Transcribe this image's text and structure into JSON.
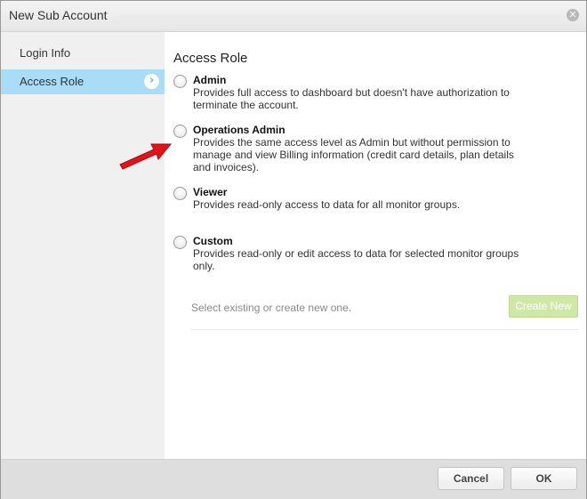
{
  "dialog": {
    "title": "New Sub Account",
    "close_icon": "close-icon"
  },
  "sidebar": {
    "items": [
      {
        "label": "Login Info",
        "active": false
      },
      {
        "label": "Access Role",
        "active": true,
        "icon": "chevron-right-icon"
      }
    ]
  },
  "main": {
    "heading": "Access Role",
    "options": [
      {
        "title": "Admin",
        "description": "Provides full access to dashboard but doesn't have authorization to terminate the account.",
        "selected": false
      },
      {
        "title": "Operations Admin",
        "description": "Provides the same access level as Admin but without permission to manage and view Billing information (credit card details, plan details and invoices).",
        "selected": false
      },
      {
        "title": "Viewer",
        "description": "Provides read-only access to data for all monitor groups.",
        "selected": false
      },
      {
        "title": "Custom",
        "description": "Provides read-only or edit access to data for selected monitor groups only.",
        "selected": false
      }
    ],
    "custom_group": {
      "placeholder_text": "Select existing or create new one.",
      "create_new_label": "Create New"
    }
  },
  "annotation": {
    "icon": "red-arrow-icon",
    "color": "#e2141b"
  },
  "footer": {
    "cancel_label": "Cancel",
    "ok_label": "OK"
  }
}
